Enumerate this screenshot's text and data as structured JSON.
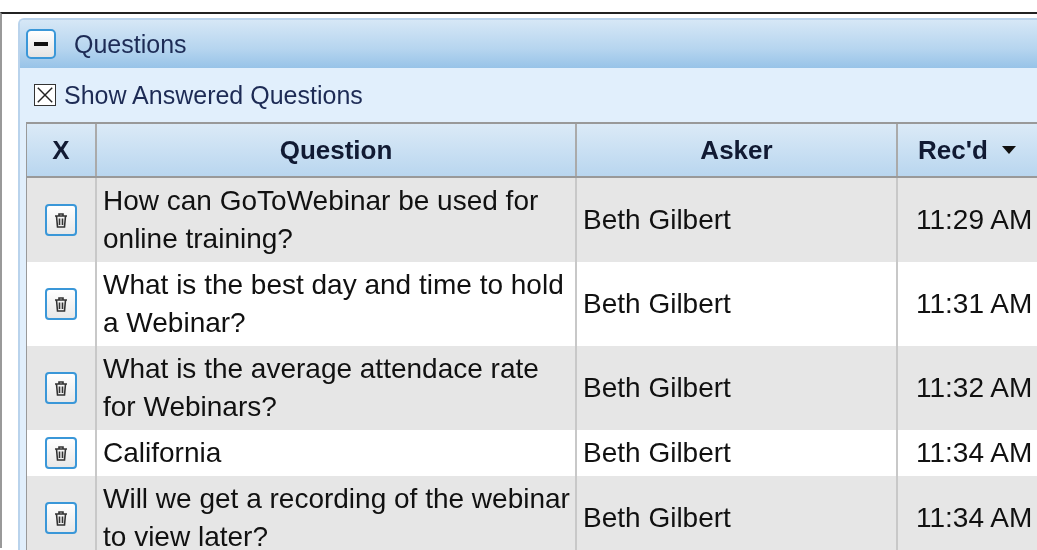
{
  "panel": {
    "title": "Questions",
    "expanded": true
  },
  "show_answered": {
    "label": "Show Answered Questions",
    "checked": true
  },
  "table": {
    "columns": [
      {
        "label": "X",
        "sorted": false
      },
      {
        "label": "Question",
        "sorted": false
      },
      {
        "label": "Asker",
        "sorted": false
      },
      {
        "label": "Rec'd",
        "sorted": true
      }
    ],
    "rows": [
      {
        "question": "How can GoToWebinar be used for online training?",
        "asker": "Beth Gilbert",
        "received": "11:29 AM"
      },
      {
        "question": "What is the best day and time to hold a Webinar?",
        "asker": "Beth Gilbert",
        "received": "11:31 AM"
      },
      {
        "question": "What is the average attendace rate for Webinars?",
        "asker": "Beth Gilbert",
        "received": "11:32 AM"
      },
      {
        "question": "California",
        "asker": "Beth Gilbert",
        "received": "11:34 AM"
      },
      {
        "question": "Will we get a recording of the webinar to view later?",
        "asker": "Beth Gilbert",
        "received": "11:34 AM"
      }
    ]
  }
}
